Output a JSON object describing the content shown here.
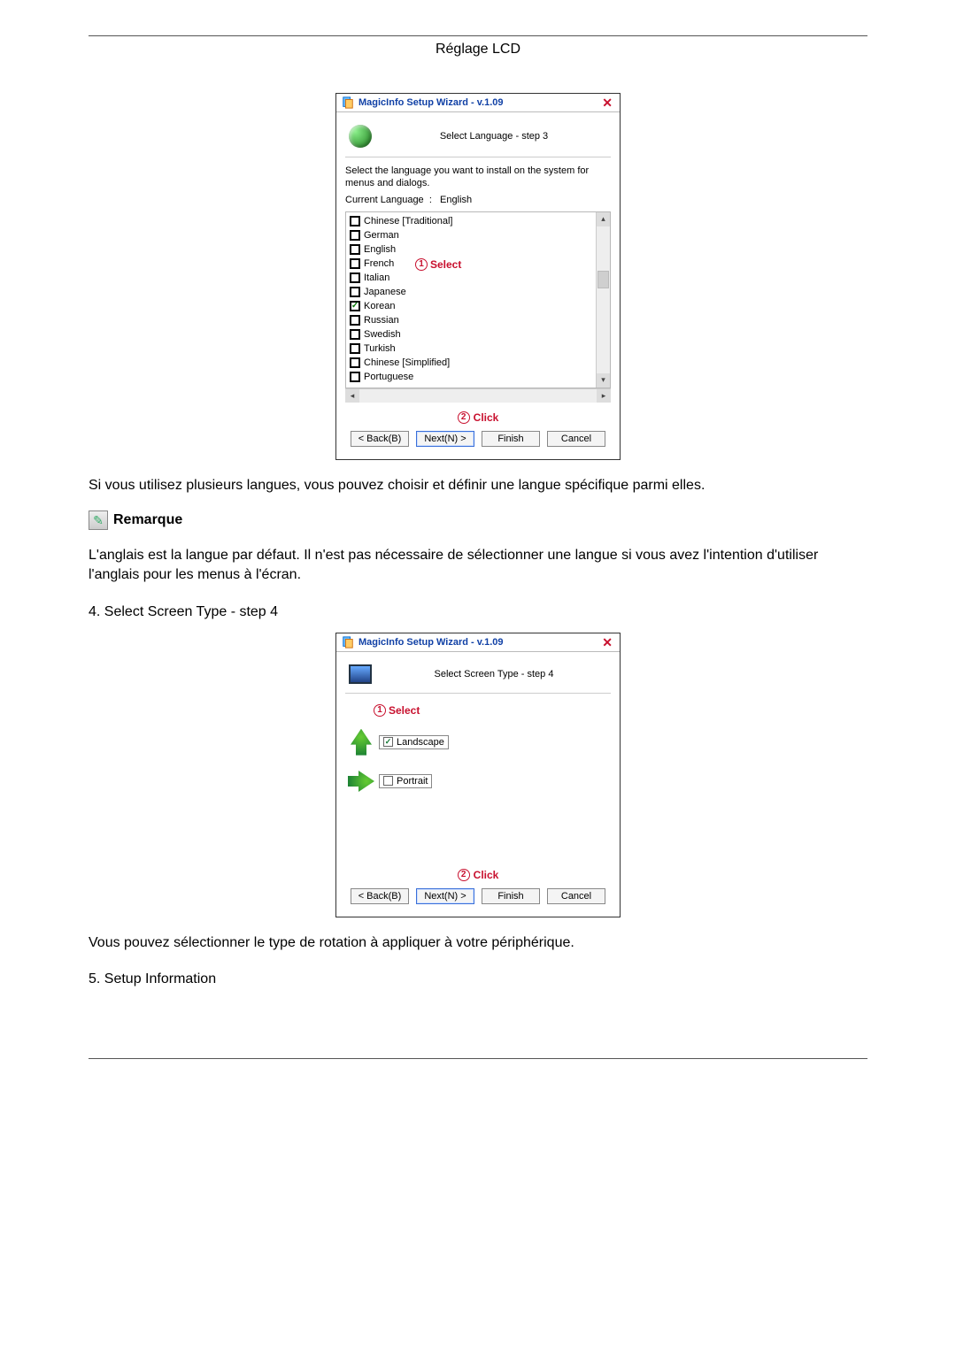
{
  "header": {
    "title": "Réglage LCD"
  },
  "dialog1": {
    "window_title": "MagicInfo Setup Wizard - v.1.09",
    "step_title": "Select Language - step 3",
    "instruction": "Select the language you want to install on the system for menus and dialogs.",
    "current_language_label": "Current Language",
    "current_language_sep": ":",
    "current_language_value": "English",
    "languages": [
      {
        "label": "Chinese [Traditional]",
        "checked": false
      },
      {
        "label": "German",
        "checked": false
      },
      {
        "label": "English",
        "checked": false
      },
      {
        "label": "French",
        "checked": false
      },
      {
        "label": "Italian",
        "checked": false
      },
      {
        "label": "Japanese",
        "checked": false
      },
      {
        "label": "Korean",
        "checked": true
      },
      {
        "label": "Russian",
        "checked": false
      },
      {
        "label": "Swedish",
        "checked": false
      },
      {
        "label": "Turkish",
        "checked": false
      },
      {
        "label": "Chinese [Simplified]",
        "checked": false
      },
      {
        "label": "Portuguese",
        "checked": false
      }
    ],
    "annotations": {
      "select_badge": "1",
      "select_text": "Select",
      "click_badge": "2",
      "click_text": "Click"
    },
    "buttons": {
      "back": "< Back(B)",
      "next": "Next(N) >",
      "finish": "Finish",
      "cancel": "Cancel"
    }
  },
  "para1": "Si vous utilisez plusieurs langues, vous pouvez choisir et définir une langue spécifique parmi elles.",
  "remark_label": "Remarque",
  "para2": "L'anglais est la langue par défaut. Il n'est pas nécessaire de sélectionner une langue si vous avez l'intention d'utiliser l'anglais pour les menus à l'écran.",
  "step4_line": "4. Select Screen Type - step 4",
  "dialog2": {
    "window_title": "MagicInfo Setup Wizard - v.1.09",
    "step_title": "Select Screen Type - step 4",
    "annotations": {
      "select_badge": "1",
      "select_text": "Select",
      "click_badge": "2",
      "click_text": "Click"
    },
    "options": {
      "landscape": {
        "label": "Landscape",
        "checked": true
      },
      "portrait": {
        "label": "Portrait",
        "checked": false
      }
    },
    "buttons": {
      "back": "< Back(B)",
      "next": "Next(N) >",
      "finish": "Finish",
      "cancel": "Cancel"
    }
  },
  "para3": "Vous pouvez sélectionner le type de rotation à appliquer à votre périphérique.",
  "step5_line": "5. Setup Information"
}
